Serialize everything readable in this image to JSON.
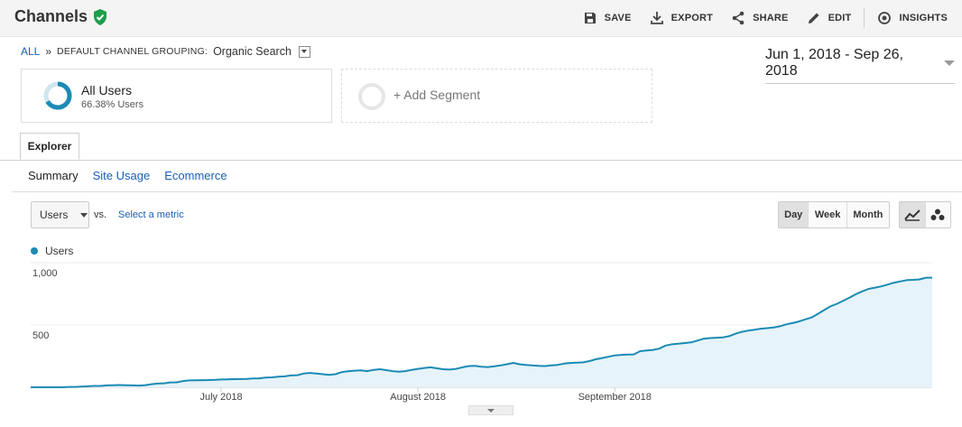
{
  "header": {
    "title": "Channels",
    "actions": [
      {
        "label": "SAVE",
        "icon": "save-icon"
      },
      {
        "label": "EXPORT",
        "icon": "download-icon"
      },
      {
        "label": "SHARE",
        "icon": "share-icon"
      },
      {
        "label": "EDIT",
        "icon": "pencil-icon"
      },
      {
        "label": "INSIGHTS",
        "icon": "insights-icon"
      }
    ]
  },
  "breadcrumb": {
    "all": "ALL",
    "separator": "»",
    "grouping": "DEFAULT CHANNEL GROUPING:",
    "value": "Organic Search"
  },
  "date_range": "Jun 1, 2018 - Sep 26, 2018",
  "segments": {
    "primary": {
      "name": "All Users",
      "sub": "66.38% Users",
      "percent": 66.38
    },
    "add_label": "+ Add Segment"
  },
  "tabs": {
    "explorer": "Explorer",
    "subtabs": [
      "Summary",
      "Site Usage",
      "Ecommerce"
    ],
    "active_subtab": "Summary"
  },
  "metric": {
    "selected": "Users",
    "vs": "vs.",
    "select_label": "Select a metric"
  },
  "period_buttons": [
    "Day",
    "Week",
    "Month"
  ],
  "active_period": "Day",
  "colors": {
    "series": "#1b8bb4",
    "area": "#e6f3fa",
    "accent": "#1a5fb4",
    "shield": "#1e9e4a"
  },
  "chart_data": {
    "type": "area",
    "series": [
      {
        "name": "Users",
        "values": [
          0,
          0,
          0,
          0,
          0,
          0,
          3,
          3,
          6,
          8,
          11,
          11,
          15,
          17,
          18,
          17,
          15,
          14,
          17,
          25,
          30,
          32,
          39,
          40,
          50,
          55,
          56,
          57,
          58,
          60,
          62,
          64,
          65,
          66,
          67,
          70,
          72,
          78,
          80,
          85,
          88,
          95,
          97,
          110,
          115,
          110,
          105,
          100,
          105,
          122,
          128,
          133,
          136,
          130,
          140,
          145,
          138,
          130,
          125,
          130,
          140,
          148,
          155,
          160,
          152,
          145,
          142,
          148,
          160,
          170,
          172,
          165,
          162,
          168,
          175,
          185,
          196,
          185,
          180,
          176,
          172,
          170,
          175,
          180,
          190,
          195,
          198,
          200,
          210,
          225,
          235,
          245,
          256,
          260,
          262,
          264,
          290,
          296,
          300,
          310,
          335,
          345,
          350,
          355,
          360,
          375,
          390,
          395,
          398,
          400,
          410,
          430,
          445,
          455,
          462,
          470,
          475,
          480,
          490,
          505,
          515,
          528,
          545,
          560,
          590,
          620,
          650,
          670,
          695,
          720,
          748,
          770,
          790,
          800,
          810,
          825,
          840,
          850,
          860,
          862,
          866,
          880,
          880
        ]
      }
    ],
    "x_tick_labels": [
      "July 2018",
      "August 2018",
      "September 2018"
    ],
    "x_tick_index": [
      30,
      61,
      92
    ],
    "y_tick_labels": [
      "1,000",
      "500"
    ],
    "y_tick_values": [
      1000,
      500
    ],
    "ylim": [
      0,
      1000
    ],
    "grid": true,
    "legend": "top-left"
  }
}
